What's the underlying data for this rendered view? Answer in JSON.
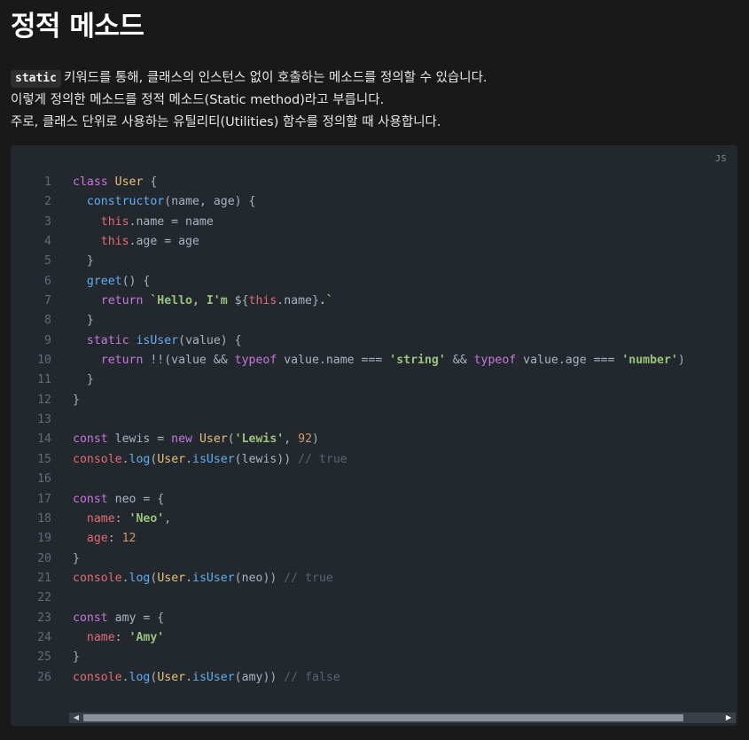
{
  "title": "정적 메소드",
  "paragraph": {
    "inline_code": "static",
    "line1_rest": "키워드를 통해, 클래스의 인스턴스 없이 호출하는 메소드를 정의할 수 있습니다.",
    "line2": "이렇게 정의한 메소드를 정적 메소드(Static method)라고 부릅니다.",
    "line3": "주로, 클래스 단위로 사용하는 유틸리티(Utilities) 함수를 정의할 때 사용합니다."
  },
  "code_block": {
    "language_label": "JS",
    "lines": [
      [
        [
          "keyword",
          "class "
        ],
        [
          "class",
          "User"
        ],
        [
          "punct",
          " {"
        ]
      ],
      [
        [
          "plain",
          "  "
        ],
        [
          "func",
          "constructor"
        ],
        [
          "punct",
          "("
        ],
        [
          "plain",
          "name, age"
        ],
        [
          "punct",
          ") {"
        ]
      ],
      [
        [
          "plain",
          "    "
        ],
        [
          "this",
          "this"
        ],
        [
          "plain",
          ".name = name"
        ]
      ],
      [
        [
          "plain",
          "    "
        ],
        [
          "this",
          "this"
        ],
        [
          "plain",
          ".age = age"
        ]
      ],
      [
        [
          "punct",
          "  }"
        ]
      ],
      [
        [
          "plain",
          "  "
        ],
        [
          "func",
          "greet"
        ],
        [
          "punct",
          "() {"
        ]
      ],
      [
        [
          "plain",
          "    "
        ],
        [
          "keyword",
          "return "
        ],
        [
          "string",
          "`Hello, I'm "
        ],
        [
          "plain",
          "${"
        ],
        [
          "this",
          "this"
        ],
        [
          "plain",
          ".name}"
        ],
        [
          "string",
          ".`"
        ]
      ],
      [
        [
          "punct",
          "  }"
        ]
      ],
      [
        [
          "plain",
          "  "
        ],
        [
          "keyword",
          "static "
        ],
        [
          "func",
          "isUser"
        ],
        [
          "punct",
          "("
        ],
        [
          "plain",
          "value"
        ],
        [
          "punct",
          ") {"
        ]
      ],
      [
        [
          "plain",
          "    "
        ],
        [
          "keyword",
          "return "
        ],
        [
          "plain",
          "!!(value && "
        ],
        [
          "keyword",
          "typeof "
        ],
        [
          "plain",
          "value.name === "
        ],
        [
          "string",
          "'string'"
        ],
        [
          "plain",
          " && "
        ],
        [
          "keyword",
          "typeof "
        ],
        [
          "plain",
          "value.age === "
        ],
        [
          "string",
          "'number'"
        ],
        [
          "punct",
          ")"
        ]
      ],
      [
        [
          "punct",
          "  }"
        ]
      ],
      [
        [
          "punct",
          "}"
        ]
      ],
      [],
      [
        [
          "keyword",
          "const "
        ],
        [
          "plain",
          "lewis = "
        ],
        [
          "keyword",
          "new "
        ],
        [
          "class",
          "User"
        ],
        [
          "punct",
          "("
        ],
        [
          "string",
          "'Lewis'"
        ],
        [
          "punct",
          ", "
        ],
        [
          "number",
          "92"
        ],
        [
          "punct",
          ")"
        ]
      ],
      [
        [
          "console",
          "console"
        ],
        [
          "punct",
          "."
        ],
        [
          "method",
          "log"
        ],
        [
          "punct",
          "("
        ],
        [
          "class",
          "User"
        ],
        [
          "punct",
          "."
        ],
        [
          "method",
          "isUser"
        ],
        [
          "punct",
          "("
        ],
        [
          "plain",
          "lewis"
        ],
        [
          "punct",
          "))"
        ],
        [
          "comment",
          " // true"
        ]
      ],
      [],
      [
        [
          "keyword",
          "const "
        ],
        [
          "plain",
          "neo = {"
        ]
      ],
      [
        [
          "plain",
          "  "
        ],
        [
          "prop",
          "name"
        ],
        [
          "punct",
          ": "
        ],
        [
          "string",
          "'Neo'"
        ],
        [
          "punct",
          ","
        ]
      ],
      [
        [
          "plain",
          "  "
        ],
        [
          "prop",
          "age"
        ],
        [
          "punct",
          ": "
        ],
        [
          "number",
          "12"
        ]
      ],
      [
        [
          "punct",
          "}"
        ]
      ],
      [
        [
          "console",
          "console"
        ],
        [
          "punct",
          "."
        ],
        [
          "method",
          "log"
        ],
        [
          "punct",
          "("
        ],
        [
          "class",
          "User"
        ],
        [
          "punct",
          "."
        ],
        [
          "method",
          "isUser"
        ],
        [
          "punct",
          "("
        ],
        [
          "plain",
          "neo"
        ],
        [
          "punct",
          "))"
        ],
        [
          "comment",
          " // true"
        ]
      ],
      [],
      [
        [
          "keyword",
          "const "
        ],
        [
          "plain",
          "amy = {"
        ]
      ],
      [
        [
          "plain",
          "  "
        ],
        [
          "prop",
          "name"
        ],
        [
          "punct",
          ": "
        ],
        [
          "string",
          "'Amy'"
        ]
      ],
      [
        [
          "punct",
          "}"
        ]
      ],
      [
        [
          "console",
          "console"
        ],
        [
          "punct",
          "."
        ],
        [
          "method",
          "log"
        ],
        [
          "punct",
          "("
        ],
        [
          "class",
          "User"
        ],
        [
          "punct",
          "."
        ],
        [
          "method",
          "isUser"
        ],
        [
          "punct",
          "("
        ],
        [
          "plain",
          "amy"
        ],
        [
          "punct",
          "))"
        ],
        [
          "comment",
          " // false"
        ]
      ]
    ]
  },
  "scrollbar": {
    "left_arrow": "◀",
    "right_arrow": "▶",
    "thumb_fraction": 0.94
  }
}
